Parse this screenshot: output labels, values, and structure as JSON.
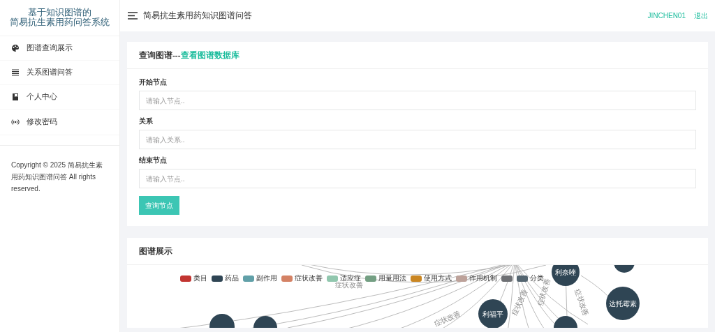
{
  "sidebar": {
    "title_lines": [
      "基于知识图谱的",
      "简易抗生素用药问答系统"
    ],
    "items": [
      {
        "label": "图谱查询展示",
        "selected": false
      },
      {
        "label": "关系图谱问答",
        "selected": false
      },
      {
        "label": "个人中心",
        "selected": false
      },
      {
        "label": "修改密码",
        "selected": false
      }
    ],
    "copyright": "Copyright © 2025 简易抗生素用药知识图谱问答 All rights reserved."
  },
  "header": {
    "title": "简易抗生素用药知识图谱问答",
    "user": "JINCHEN01",
    "logout": "退出"
  },
  "query_card": {
    "title": "查询图谱---",
    "link": "查看图谱数据库",
    "fields": [
      {
        "label": "开始节点",
        "placeholder": "请输入节点.."
      },
      {
        "label": "关系",
        "placeholder": "请输入关系.."
      },
      {
        "label": "结束节点",
        "placeholder": "请输入节点.."
      }
    ],
    "button": "查询节点"
  },
  "graph_card": {
    "title": "图谱展示",
    "legend": [
      {
        "label": "类目",
        "color": "#c23531"
      },
      {
        "label": "药品",
        "color": "#2f4554"
      },
      {
        "label": "副作用",
        "color": "#61a0a8"
      },
      {
        "label": "症状改善",
        "color": "#d48265"
      },
      {
        "label": "适应症",
        "color": "#91c7ae"
      },
      {
        "label": "用量用法",
        "color": "#749f83"
      },
      {
        "label": "使用方式",
        "color": "#ca8622"
      },
      {
        "label": "作用机制",
        "color": "#bda29a"
      },
      {
        "color": "#6e7074"
      },
      {
        "label": "分类",
        "color": "#546570"
      }
    ],
    "nodes": [
      {
        "label": "利福平"
      },
      {
        "label": "利奈唑"
      },
      {
        "label": "达托霉素"
      }
    ],
    "edges": [
      {
        "label": "症状改善"
      },
      {
        "label": "症状改善"
      },
      {
        "label": "症状改善"
      },
      {
        "label": "症状改善"
      },
      {
        "label": "症状改善"
      }
    ]
  }
}
